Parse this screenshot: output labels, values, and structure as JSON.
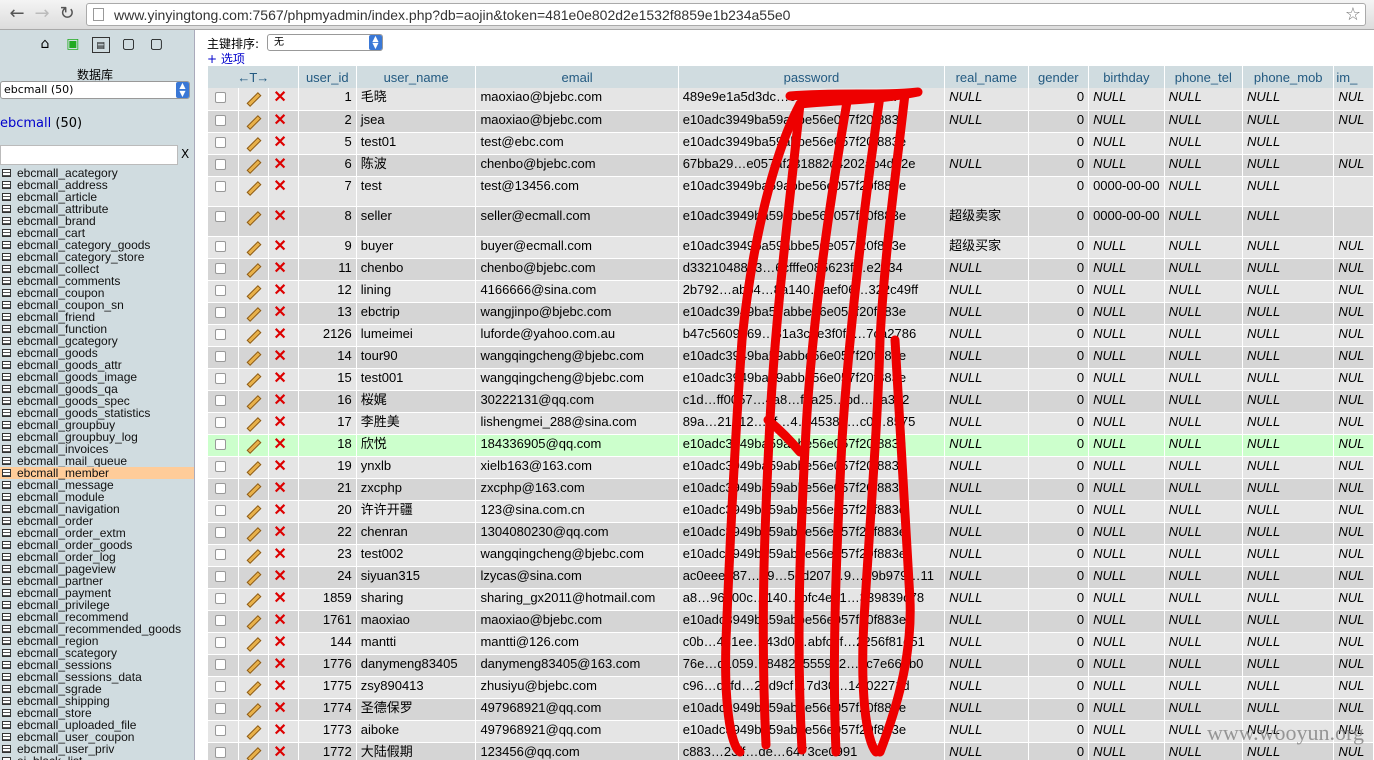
{
  "browser": {
    "url": "www.yinyingtong.com:7567/phpmyadmin/index.php?db=aojin&token=481e0e802d2e1532f8859e1b234a55e0"
  },
  "sidebar": {
    "db_label": "数据库",
    "db_select": "ebcmall (50)",
    "db_name": "ebcmall",
    "db_count": "(50)",
    "filter_clear": "X",
    "tables": [
      "ebcmall_acategory",
      "ebcmall_address",
      "ebcmall_article",
      "ebcmall_attribute",
      "ebcmall_brand",
      "ebcmall_cart",
      "ebcmall_category_goods",
      "ebcmall_category_store",
      "ebcmall_collect",
      "ebcmall_comments",
      "ebcmall_coupon",
      "ebcmall_coupon_sn",
      "ebcmall_friend",
      "ebcmall_function",
      "ebcmall_gcategory",
      "ebcmall_goods",
      "ebcmall_goods_attr",
      "ebcmall_goods_image",
      "ebcmall_goods_qa",
      "ebcmall_goods_spec",
      "ebcmall_goods_statistics",
      "ebcmall_groupbuy",
      "ebcmall_groupbuy_log",
      "ebcmall_invoices",
      "ebcmall_mail_queue",
      "ebcmall_member",
      "ebcmall_message",
      "ebcmall_module",
      "ebcmall_navigation",
      "ebcmall_order",
      "ebcmall_order_extm",
      "ebcmall_order_goods",
      "ebcmall_order_log",
      "ebcmall_pageview",
      "ebcmall_partner",
      "ebcmall_payment",
      "ebcmall_privilege",
      "ebcmall_recommend",
      "ebcmall_recommended_goods",
      "ebcmall_region",
      "ebcmall_scategory",
      "ebcmall_sessions",
      "ebcmall_sessions_data",
      "ebcmall_sgrade",
      "ebcmall_shipping",
      "ebcmall_store",
      "ebcmall_uploaded_file",
      "ebcmall_user_coupon",
      "ebcmall_user_priv",
      "ei_black_list"
    ],
    "active_table": "ebcmall_member"
  },
  "main": {
    "sort_label": "主键排序:",
    "sort_value": "无",
    "options_label": "+ 选项",
    "columns": [
      "user_id",
      "user_name",
      "email",
      "password",
      "real_name",
      "gender",
      "birthday",
      "phone_tel",
      "phone_mob",
      "im_"
    ],
    "rows": [
      {
        "user_id": "1",
        "user_name": "毛晓",
        "email": "maoxiao@bjebc.com",
        "password": "489e9e1a5d3dc…05981b569…d39a",
        "real_name": "NULL",
        "gender": "0",
        "birthday": "NULL",
        "phone_tel": "NULL",
        "phone_mob": "NULL",
        "im": "NUL"
      },
      {
        "user_id": "2",
        "user_name": "jsea",
        "email": "maoxiao@bjebc.com",
        "password": "e10adc3949ba59abbe56e057f20f883e",
        "real_name": "NULL",
        "gender": "0",
        "birthday": "NULL",
        "phone_tel": "NULL",
        "phone_mob": "NULL",
        "im": "NUL"
      },
      {
        "user_id": "5",
        "user_name": "test01",
        "email": "test@ebc.com",
        "password": "e10adc3949ba59abbe56e057f20f883e",
        "real_name": "",
        "gender": "0",
        "birthday": "NULL",
        "phone_tel": "NULL",
        "phone_mob": "NULL",
        "im": ""
      },
      {
        "user_id": "6",
        "user_name": "陈波",
        "email": "chenbo@bjebc.com",
        "password": "67bba29…e057af231882c4202ab4d82e",
        "real_name": "NULL",
        "gender": "0",
        "birthday": "NULL",
        "phone_tel": "NULL",
        "phone_mob": "NULL",
        "im": "NUL"
      },
      {
        "user_id": "7",
        "user_name": "test",
        "email": "test@13456.com",
        "password": "e10adc3949ba59abbe56e057f20f883e",
        "real_name": "",
        "gender": "0",
        "birthday": "0000-00-00",
        "phone_tel": "NULL",
        "phone_mob": "NULL",
        "im": ""
      },
      {
        "user_id": "8",
        "user_name": "seller",
        "email": "seller@ecmall.com",
        "password": "e10adc3949ba59abbe56e057f20f883e",
        "real_name": "超级卖家",
        "gender": "0",
        "birthday": "0000-00-00",
        "phone_tel": "NULL",
        "phone_mob": "NULL",
        "im": ""
      },
      {
        "user_id": "9",
        "user_name": "buyer",
        "email": "buyer@ecmall.com",
        "password": "e10adc3949ba59abbe56e057f20f883e",
        "real_name": "超级买家",
        "gender": "0",
        "birthday": "NULL",
        "phone_tel": "NULL",
        "phone_mob": "NULL",
        "im": "NUL"
      },
      {
        "user_id": "11",
        "user_name": "chenbo",
        "email": "chenbo@bjebc.com",
        "password": "d3321048883…6cfffe085623f…e2134",
        "real_name": "NULL",
        "gender": "0",
        "birthday": "NULL",
        "phone_tel": "NULL",
        "phone_mob": "NULL",
        "im": "NUL"
      },
      {
        "user_id": "12",
        "user_name": "lining",
        "email": "4166666@sina.com",
        "password": "2b792…abb4…8a140…aef06…322c49ff",
        "real_name": "NULL",
        "gender": "0",
        "birthday": "NULL",
        "phone_tel": "NULL",
        "phone_mob": "NULL",
        "im": "NUL"
      },
      {
        "user_id": "13",
        "user_name": "ebctrip",
        "email": "wangjinpo@bjebc.com",
        "password": "e10adc3949ba59abbe56e057f20f883e",
        "real_name": "NULL",
        "gender": "0",
        "birthday": "NULL",
        "phone_tel": "NULL",
        "phone_mob": "NULL",
        "im": "NUL"
      },
      {
        "user_id": "2126",
        "user_name": "lumeimei",
        "email": "luforde@yahoo.com.au",
        "password": "b47c5609469…81a3c0e3f0f4…7ca2786",
        "real_name": "NULL",
        "gender": "0",
        "birthday": "NULL",
        "phone_tel": "NULL",
        "phone_mob": "NULL",
        "im": "NUL"
      },
      {
        "user_id": "14",
        "user_name": "tour90",
        "email": "wangqingcheng@bjebc.com",
        "password": "e10adc3949ba59abbe56e057f20f883e",
        "real_name": "NULL",
        "gender": "0",
        "birthday": "NULL",
        "phone_tel": "NULL",
        "phone_mob": "NULL",
        "im": "NUL"
      },
      {
        "user_id": "15",
        "user_name": "test001",
        "email": "wangqingcheng@bjebc.com",
        "password": "e10adc3949ba59abbe56e057f20f883e",
        "real_name": "NULL",
        "gender": "0",
        "birthday": "NULL",
        "phone_tel": "NULL",
        "phone_mob": "NULL",
        "im": "NUL"
      },
      {
        "user_id": "16",
        "user_name": "桜娓",
        "email": "30222131@qq.com",
        "password": "c1d…ff0057…4a8…fea25…bd…7a3d2",
        "real_name": "NULL",
        "gender": "0",
        "birthday": "NULL",
        "phone_tel": "NULL",
        "phone_mob": "NULL",
        "im": "NUL"
      },
      {
        "user_id": "17",
        "user_name": "李胜美",
        "email": "lishengmei_288@sina.com",
        "password": "89a…21312…bf…4…45387…c0…8575",
        "real_name": "NULL",
        "gender": "0",
        "birthday": "NULL",
        "phone_tel": "NULL",
        "phone_mob": "NULL",
        "im": "NUL"
      },
      {
        "user_id": "18",
        "user_name": "欣悦",
        "email": "184336905@qq.com",
        "password": "e10adc3949ba59abbe56e057f20f883e",
        "real_name": "NULL",
        "gender": "0",
        "birthday": "NULL",
        "phone_tel": "NULL",
        "phone_mob": "NULL",
        "im": "NUL"
      },
      {
        "user_id": "19",
        "user_name": "ynxlb",
        "email": "xielb163@163.com",
        "password": "e10adc3949ba59abbe56e057f20f883e",
        "real_name": "NULL",
        "gender": "0",
        "birthday": "NULL",
        "phone_tel": "NULL",
        "phone_mob": "NULL",
        "im": "NUL"
      },
      {
        "user_id": "21",
        "user_name": "zxcphp",
        "email": "zxcphp@163.com",
        "password": "e10adc3949ba59abbe56e057f20f883e",
        "real_name": "NULL",
        "gender": "0",
        "birthday": "NULL",
        "phone_tel": "NULL",
        "phone_mob": "NULL",
        "im": "NUL"
      },
      {
        "user_id": "20",
        "user_name": "许许开疆",
        "email": "123@sina.com.cn",
        "password": "e10adc3949ba59abbe56e057f20f883e",
        "real_name": "NULL",
        "gender": "0",
        "birthday": "NULL",
        "phone_tel": "NULL",
        "phone_mob": "NULL",
        "im": "NUL"
      },
      {
        "user_id": "22",
        "user_name": "chenran",
        "email": "1304080230@qq.com",
        "password": "e10adc3949ba59abbe56e057f20f883e",
        "real_name": "NULL",
        "gender": "0",
        "birthday": "NULL",
        "phone_tel": "NULL",
        "phone_mob": "NULL",
        "im": "NUL"
      },
      {
        "user_id": "23",
        "user_name": "test002",
        "email": "wangqingcheng@bjebc.com",
        "password": "e10adc3949ba59abbe56e057f20f883e",
        "real_name": "NULL",
        "gender": "0",
        "birthday": "NULL",
        "phone_tel": "NULL",
        "phone_mob": "NULL",
        "im": "NUL"
      },
      {
        "user_id": "24",
        "user_name": "siyuan315",
        "email": "lzycas@sina.com",
        "password": "ac0eee787…39…5ed207…9…69b979…11",
        "real_name": "NULL",
        "gender": "0",
        "birthday": "NULL",
        "phone_tel": "NULL",
        "phone_mob": "NULL",
        "im": "NUL"
      },
      {
        "user_id": "1859",
        "user_name": "sharing",
        "email": "sharing_gx2011@hotmail.com",
        "password": "a8…96200c…140…bfc4e51…339839c78",
        "real_name": "NULL",
        "gender": "0",
        "birthday": "NULL",
        "phone_tel": "NULL",
        "phone_mob": "NULL",
        "im": "NUL"
      },
      {
        "user_id": "1761",
        "user_name": "maoxiao",
        "email": "maoxiao@bjebc.com",
        "password": "e10adc3949ba59abbe56e057f20f883e",
        "real_name": "NULL",
        "gender": "0",
        "birthday": "NULL",
        "phone_tel": "NULL",
        "phone_mob": "NULL",
        "im": "NUL"
      },
      {
        "user_id": "144",
        "user_name": "mantti",
        "email": "mantti@126.com",
        "password": "c0b…431ee…43d0…abfc2f…2256f81e51",
        "real_name": "NULL",
        "gender": "0",
        "birthday": "NULL",
        "phone_tel": "NULL",
        "phone_mob": "NULL",
        "im": "NUL"
      },
      {
        "user_id": "1776",
        "user_name": "danymeng83405",
        "email": "danymeng83405@163.com",
        "password": "76e…d1059…84820555902…6c7e669b0",
        "real_name": "NULL",
        "gender": "0",
        "birthday": "NULL",
        "phone_tel": "NULL",
        "phone_mob": "NULL",
        "im": "NUL"
      },
      {
        "user_id": "1775",
        "user_name": "zsy890413",
        "email": "zhusiyu@bjebc.com",
        "password": "c96…dcfd…2dd9cf…7d30…14f02271d",
        "real_name": "NULL",
        "gender": "0",
        "birthday": "NULL",
        "phone_tel": "NULL",
        "phone_mob": "NULL",
        "im": "NUL"
      },
      {
        "user_id": "1774",
        "user_name": "圣德保罗",
        "email": "497968921@qq.com",
        "password": "e10adc3949ba59abbe56e057f20f883e",
        "real_name": "NULL",
        "gender": "0",
        "birthday": "NULL",
        "phone_tel": "NULL",
        "phone_mob": "NULL",
        "im": "NUL"
      },
      {
        "user_id": "1773",
        "user_name": "aiboke",
        "email": "497968921@qq.com",
        "password": "e10adc3949ba59abbe56e057f20f883e",
        "real_name": "NULL",
        "gender": "0",
        "birthday": "NULL",
        "phone_tel": "NULL",
        "phone_mob": "NULL",
        "im": "NUL"
      },
      {
        "user_id": "1772",
        "user_name": "大陆假期",
        "email": "123456@qq.com",
        "password": "c883…23ff…de…6473ce0991",
        "real_name": "NULL",
        "gender": "0",
        "birthday": "NULL",
        "phone_tel": "NULL",
        "phone_mob": "NULL",
        "im": "NUL"
      }
    ],
    "highlight_row": 15
  },
  "watermark": "www.wooyun.org",
  "colors": {
    "scribble": "#ee0000",
    "link": "#235a81",
    "header_bg": "#d0dce0",
    "highlight": "#ccffcc"
  }
}
